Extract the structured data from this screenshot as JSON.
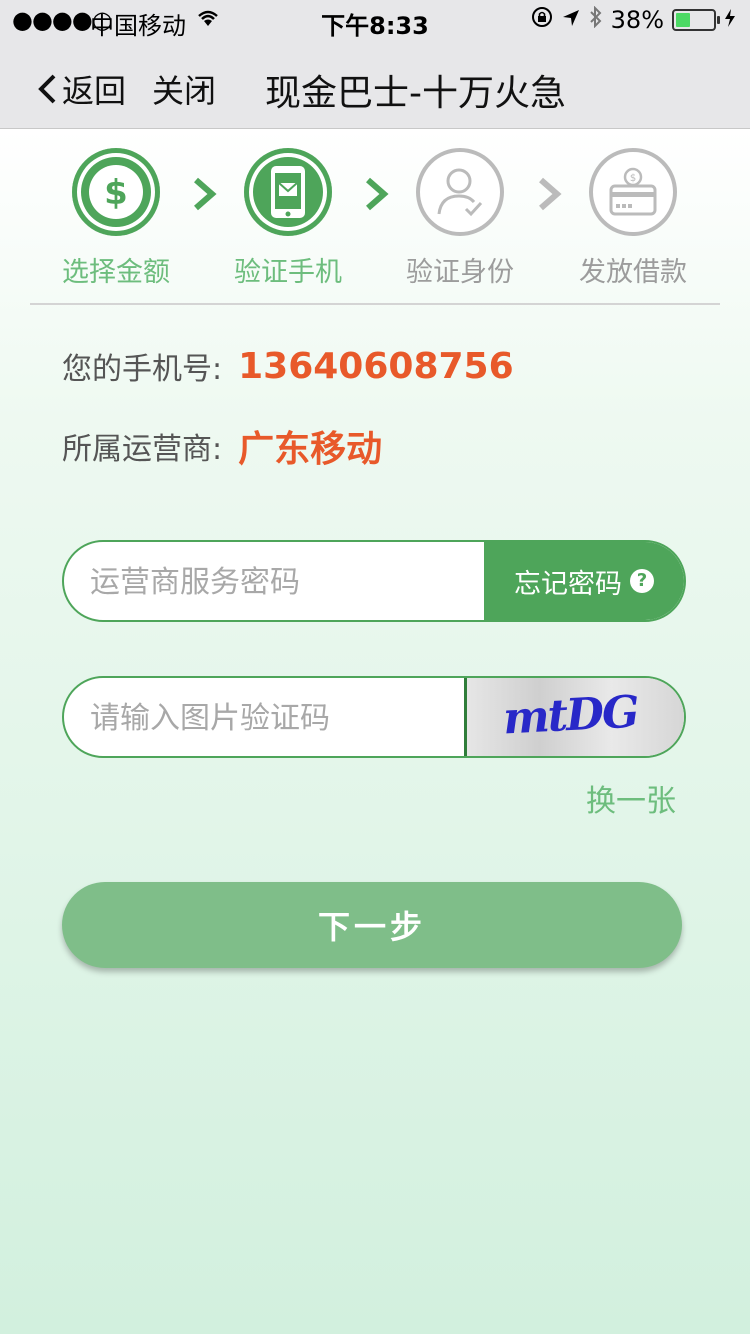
{
  "status_bar": {
    "signal": "●●●●○",
    "carrier": "中国移动",
    "time": "下午8:33",
    "battery_percent": "38%",
    "battery_level": 0.38
  },
  "nav": {
    "back_label": "返回",
    "close_label": "关闭",
    "title": "现金巴士-十万火急"
  },
  "steps": [
    {
      "label": "选择金额",
      "icon": "dollar-icon",
      "state": "active"
    },
    {
      "label": "验证手机",
      "icon": "phone-mail-icon",
      "state": "active"
    },
    {
      "label": "验证身份",
      "icon": "user-check-icon",
      "state": "inactive"
    },
    {
      "label": "发放借款",
      "icon": "card-coin-icon",
      "state": "inactive"
    }
  ],
  "info": {
    "phone_label": "您的手机号:",
    "phone_value": "13640608756",
    "carrier_label": "所属运营商:",
    "carrier_value": "广东移动"
  },
  "form": {
    "password_placeholder": "运营商服务密码",
    "forgot_label": "忘记密码",
    "captcha_placeholder": "请输入图片验证码",
    "captcha_code": "mtDG",
    "refresh_label": "换一张",
    "next_label": "下一步"
  },
  "colors": {
    "accent": "#4ea55a",
    "highlight": "#e8592a",
    "button": "#7fbe89"
  }
}
